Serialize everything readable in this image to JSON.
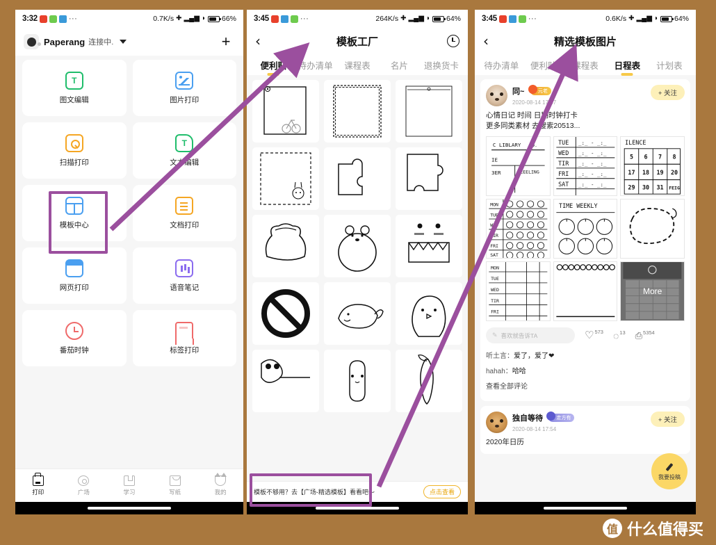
{
  "background_color": "#a9783e",
  "annotation_color": "#9b4f9e",
  "phone1": {
    "status": {
      "time": "3:32",
      "net_speed": "0.7K/s",
      "battery": "66%",
      "icons": [
        "app-red-icon",
        "app-green-icon",
        "app-blue-icon",
        "more-dots-icon",
        "bluetooth-icon",
        "signal-icon",
        "wifi-icon",
        "battery-icon"
      ]
    },
    "header": {
      "device_name": "Paperang",
      "device_state": "连接中.",
      "add_label": "+"
    },
    "grid": [
      {
        "label": "图文编辑",
        "icon": "image-text-edit-icon"
      },
      {
        "label": "图片打印",
        "icon": "image-print-icon"
      },
      {
        "label": "扫描打印",
        "icon": "scan-print-icon"
      },
      {
        "label": "文本编辑",
        "icon": "text-edit-icon"
      },
      {
        "label": "模板中心",
        "icon": "template-center-icon",
        "highlighted": true
      },
      {
        "label": "文档打印",
        "icon": "document-print-icon"
      },
      {
        "label": "网页打印",
        "icon": "web-print-icon"
      },
      {
        "label": "语音笔记",
        "icon": "voice-note-icon"
      },
      {
        "label": "番茄时钟",
        "icon": "pomodoro-clock-icon"
      },
      {
        "label": "标签打印",
        "icon": "label-print-icon"
      }
    ],
    "tabbar": [
      {
        "label": "打印",
        "icon": "printer-icon",
        "active": true
      },
      {
        "label": "广场",
        "icon": "compass-icon",
        "active": false
      },
      {
        "label": "学习",
        "icon": "book-icon",
        "active": false
      },
      {
        "label": "写纸",
        "icon": "bag-icon",
        "active": false
      },
      {
        "label": "我的",
        "icon": "cat-icon",
        "active": false
      }
    ]
  },
  "phone2": {
    "status": {
      "time": "3:45",
      "net_speed": "264K/s",
      "battery": "64%"
    },
    "nav": {
      "back": "‹",
      "title": "模板工厂",
      "right_icon": "history-clock-icon"
    },
    "tabs": [
      {
        "label": "便利贴",
        "active": true
      },
      {
        "label": "待办清单",
        "active": false
      },
      {
        "label": "课程表",
        "active": false
      },
      {
        "label": "名片",
        "active": false
      },
      {
        "label": "退换货卡",
        "active": false
      }
    ],
    "templates": [
      "frame-with-owl-bicycle",
      "stamp-scallop-frame",
      "thin-line-frame",
      "dashed-frame-bunny",
      "puzzle-piece-left",
      "puzzle-piece-right",
      "bear-head-outline",
      "bear-in-circle",
      "monster-teeth-face",
      "circle-blank",
      "whale-outline",
      "chick-outline",
      "panda-peeking",
      "popsicle-ghost",
      "carrot-outline"
    ],
    "ad": {
      "text": "模板不够用？去【广场-精选模板】看看吧～",
      "button": "点击查看",
      "highlighted": true
    }
  },
  "phone3": {
    "status": {
      "time": "3:45",
      "net_speed": "0.6K/s",
      "battery": "64%"
    },
    "nav": {
      "back": "‹",
      "title": "精选模板图片"
    },
    "tabs": [
      {
        "label": "待办清单",
        "active": false
      },
      {
        "label": "便利贴",
        "active": false
      },
      {
        "label": "课程表",
        "active": false
      },
      {
        "label": "日程表",
        "active": true
      },
      {
        "label": "计划表",
        "active": false
      }
    ],
    "posts": [
      {
        "user": "同~",
        "badge": "元老",
        "date": "2020-08-14 17:47",
        "follow_label": "+ 关注",
        "text_line1": "心情日记 时间 日期时钟打卡",
        "text_line2": "更多同类素材 去搜索20513...",
        "thumbnails": [
          "library-no-table",
          "tue-wed-thu-fri-sat-lines",
          "silence-number-calendar",
          "mood-face-weekly-grid",
          "time-weekly-clocks",
          "dashed-cloud-outline",
          "mon-fri-blank-table",
          "scallop-top-notepad",
          "more-grid-overlay"
        ],
        "more_label": "More",
        "comment_placeholder": "喜欢就告诉TA",
        "like_count": "573",
        "comment_count": "13",
        "print_count": "5354",
        "comments": [
          {
            "user": "听土言：",
            "text": "爱了，爱了❤"
          },
          {
            "user": "hahah：",
            "text": "哈哈"
          }
        ],
        "view_all": "查看全部评论"
      },
      {
        "user": "独自等待",
        "badge": "走方有",
        "date": "2020-08-14 17:54",
        "follow_label": "+ 关注",
        "text_line1": "2020年日历"
      }
    ],
    "fab": {
      "label": "我要投稿",
      "icon": "pencil-icon"
    }
  },
  "watermark": {
    "logo": "值",
    "text": "什么值得买"
  }
}
